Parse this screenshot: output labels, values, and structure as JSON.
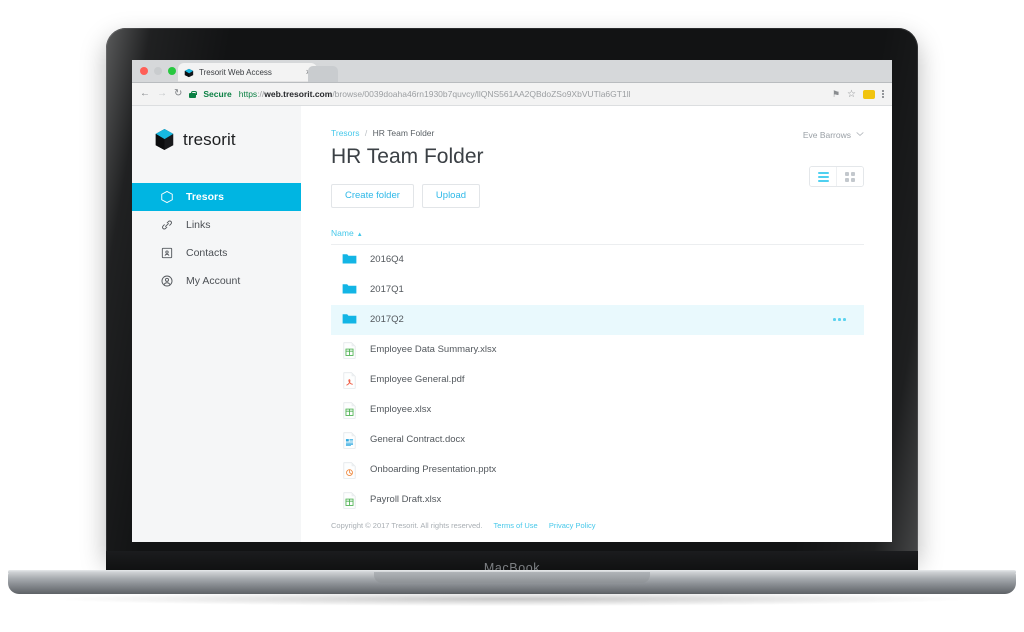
{
  "device": {
    "model_label": "MacBook"
  },
  "browser": {
    "tab": {
      "title": "Tresorit Web Access",
      "close_label": "×",
      "favicon_icon": "tresorit-cube-icon"
    },
    "toolbar": {
      "back_icon": "←",
      "forward_icon": "→",
      "reload_icon": "↻",
      "security_label": "Secure",
      "url_scheme": "https",
      "url_separator": "://",
      "url_domain": "web.tresorit.com",
      "url_path": "/browse/0039doaha46rn1930b7quvcy/llQNS561AA2QBdoZSo9XbVUTla6GT1ll",
      "pin_icon": "⚑",
      "bookmark_icon": "☆",
      "extension_icon": "extension-badge-icon",
      "menu_icon": "kebab-menu-icon"
    }
  },
  "sidebar": {
    "logo_text": "tresorit",
    "items": [
      {
        "label": "Tresors",
        "icon": "hexagon-icon",
        "active": true
      },
      {
        "label": "Links",
        "icon": "link-icon",
        "active": false
      },
      {
        "label": "Contacts",
        "icon": "contact-card-icon",
        "active": false
      },
      {
        "label": "My Account",
        "icon": "user-circle-icon",
        "active": false
      }
    ]
  },
  "main": {
    "breadcrumb": {
      "root": "Tresors",
      "separator": "/",
      "current": "HR Team Folder"
    },
    "title": "HR Team Folder",
    "buttons": {
      "create_folder": "Create folder",
      "upload": "Upload"
    },
    "user": {
      "name": "Eve Barrows",
      "caret": "⌄"
    },
    "view_toggle": {
      "list_label": "list-view",
      "grid_label": "grid-view",
      "active": "list"
    },
    "sort": {
      "column": "Name",
      "direction_arrow": "▲"
    },
    "rows": [
      {
        "name": "2016Q4",
        "type": "folder",
        "selected": false
      },
      {
        "name": "2017Q1",
        "type": "folder",
        "selected": false
      },
      {
        "name": "2017Q2",
        "type": "folder",
        "selected": true
      },
      {
        "name": "Employee Data Summary.xlsx",
        "type": "xlsx",
        "selected": false
      },
      {
        "name": "Employee General.pdf",
        "type": "pdf",
        "selected": false
      },
      {
        "name": "Employee.xlsx",
        "type": "xlsx",
        "selected": false
      },
      {
        "name": "General Contract.docx",
        "type": "docx",
        "selected": false
      },
      {
        "name": "Onboarding Presentation.pptx",
        "type": "pptx",
        "selected": false
      },
      {
        "name": "Payroll Draft.xlsx",
        "type": "xlsx",
        "selected": false
      }
    ],
    "footer": {
      "copyright": "Copyright © 2017 Tresorit. All rights reserved.",
      "terms": "Terms of Use",
      "privacy": "Privacy Policy"
    }
  },
  "colors": {
    "accent_cyan": "#00b5e2",
    "link_cyan": "#46c8ea",
    "selected_row": "#e9f9fd",
    "sidebar_bg": "#f5f6f7"
  }
}
